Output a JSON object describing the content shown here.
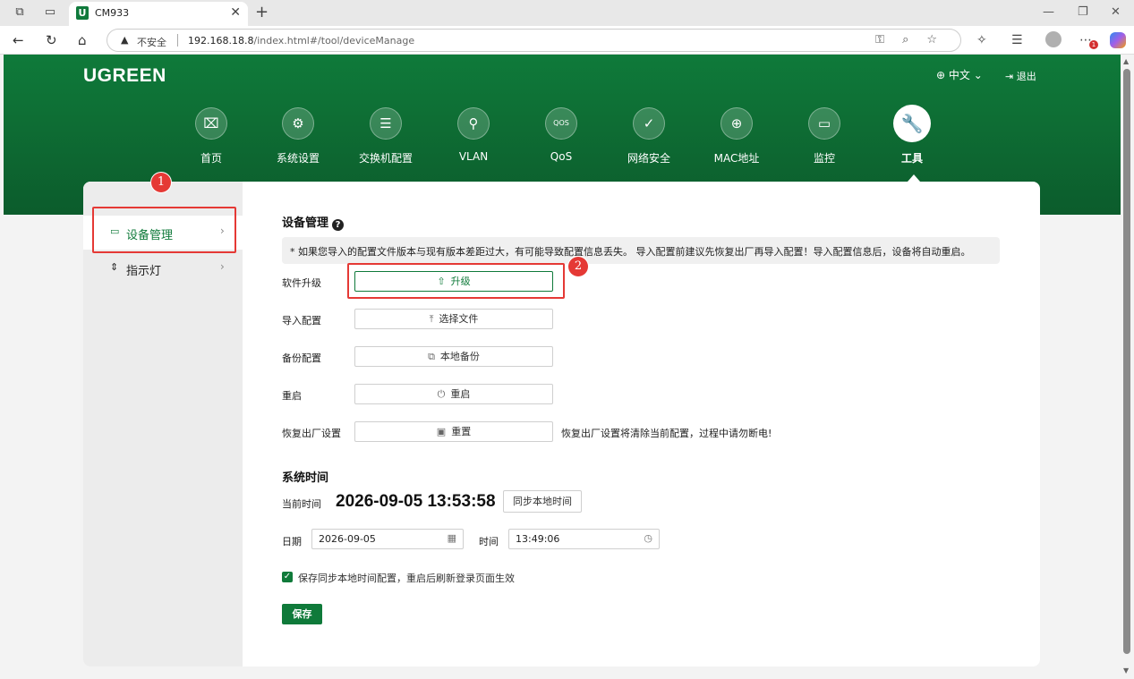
{
  "browser": {
    "tab_title": "CM933",
    "favicon_letter": "U",
    "address_insecure": "不安全",
    "url_host": "192.168.18.8",
    "url_path": "/index.html#/tool/deviceManage",
    "notification_count": "1"
  },
  "header": {
    "logo": "UGREEN",
    "language": "中文",
    "logout": "退出"
  },
  "nav": [
    {
      "label": "首页",
      "icon": "home-icon"
    },
    {
      "label": "系统设置",
      "icon": "gear-icon"
    },
    {
      "label": "交换机配置",
      "icon": "server-icon"
    },
    {
      "label": "VLAN",
      "icon": "network-icon"
    },
    {
      "label": "QoS",
      "icon": "qos-icon"
    },
    {
      "label": "网络安全",
      "icon": "shield-icon"
    },
    {
      "label": "MAC地址",
      "icon": "globe-icon"
    },
    {
      "label": "监控",
      "icon": "monitor-icon"
    },
    {
      "label": "工具",
      "icon": "wrench-icon",
      "active": true
    }
  ],
  "sidebar": {
    "items": [
      {
        "label": "设备管理",
        "active": true
      },
      {
        "label": "指示灯",
        "active": false
      }
    ]
  },
  "device": {
    "title": "设备管理",
    "notice": "* 如果您导入的配置文件版本与现有版本差距过大，有可能导致配置信息丢失。 导入配置前建议先恢复出厂再导入配置！导入配置信息后，设备将自动重启。",
    "rows": [
      {
        "label": "软件升级",
        "button": "升级"
      },
      {
        "label": "导入配置",
        "button": "选择文件"
      },
      {
        "label": "备份配置",
        "button": "本地备份"
      },
      {
        "label": "重启",
        "button": "重启"
      },
      {
        "label": "恢复出厂设置",
        "button": "重置"
      }
    ],
    "factory_hint": "恢复出厂设置将清除当前配置，过程中请勿断电!"
  },
  "system_time": {
    "title": "系统时间",
    "current_label": "当前时间",
    "current_value": "2026-09-05 13:53:58",
    "sync_button": "同步本地时间",
    "date_label": "日期",
    "date_value": "2026-09-05",
    "time_label": "时间",
    "time_value": "13:49:06",
    "checkbox_label": "保存同步本地时间配置，重启后刷新登录页面生效",
    "checkbox_checked": true,
    "save_button": "保存"
  },
  "annotations": [
    "1",
    "2"
  ],
  "colors": {
    "brand_green": "#0f7a3a",
    "annotation_red": "#e53935"
  }
}
